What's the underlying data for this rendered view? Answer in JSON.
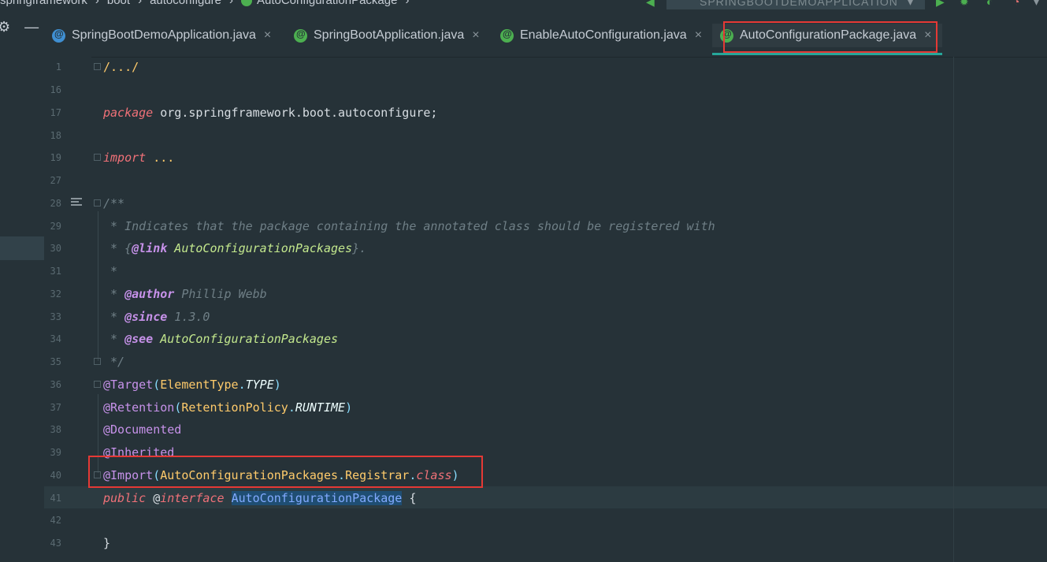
{
  "breadcrumb": {
    "items": [
      "springframework",
      "boot",
      "autoconfigure",
      "AutoConfigurationPackage"
    ]
  },
  "run_config": {
    "label": "SPRINGBOOTDEMOAPPLICATION"
  },
  "tabs": [
    {
      "label": "SpringBootDemoApplication.java",
      "icon": "spring-class-icon"
    },
    {
      "label": "SpringBootApplication.java",
      "icon": "annotation-icon"
    },
    {
      "label": "EnableAutoConfiguration.java",
      "icon": "annotation-icon"
    },
    {
      "label": "AutoConfigurationPackage.java",
      "icon": "annotation-icon",
      "active": true
    }
  ],
  "close_glyph": "×",
  "line_numbers": [
    "1",
    "16",
    "17",
    "18",
    "19",
    "27",
    "28",
    "29",
    "30",
    "31",
    "32",
    "33",
    "34",
    "35",
    "36",
    "37",
    "38",
    "39",
    "40",
    "41",
    "42",
    "43"
  ],
  "code": {
    "l1": "/.../",
    "l17_kw": "package",
    "l17_pkg": " org.springframework.boot.autoconfigure;",
    "l19_kw": "import",
    "l19_rest": " ...",
    "l28": "/**",
    "l29": " * Indicates that the package containing the annotated class should be registered with",
    "l30_a": " * {",
    "l30_tag": "@link",
    "l30_ref": " AutoConfigurationPackages",
    "l30_b": "}.",
    "l31": " *",
    "l32_a": " * ",
    "l32_tag": "@author",
    "l32_b": " Phillip Webb",
    "l33_a": " * ",
    "l33_tag": "@since",
    "l33_b": " 1.3.0",
    "l34_a": " * ",
    "l34_tag": "@see",
    "l34_ref": " AutoConfigurationPackages",
    "l35": " */",
    "l36_ann": "@Target",
    "l36_cls": "ElementType",
    "l36_const": "TYPE",
    "l37_ann": "@Retention",
    "l37_cls": "RetentionPolicy",
    "l37_const": "RUNTIME",
    "l38_ann": "@Documented",
    "l39_ann": "@Inherited",
    "l40_ann": "@Import",
    "l40_cls": "AutoConfigurationPackages",
    "l40_cls2": "Registrar",
    "l40_kw": "class",
    "l41_kw": "public",
    "l41_at": " @",
    "l41_kw2": "interface",
    "l41_name": "AutoConfigurationPackage",
    "l41_brace": " {",
    "l43": "}"
  }
}
